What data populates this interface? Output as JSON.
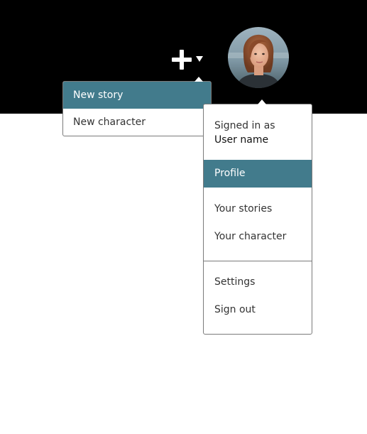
{
  "colors": {
    "topbar": "#000000",
    "accent": "#427b8c",
    "menu_border": "#7a7a7a",
    "text": "#333333"
  },
  "header": {
    "create_icon": "plus-icon",
    "create_caret_icon": "caret-down-icon",
    "avatar_icon": "user-avatar"
  },
  "create_menu": {
    "items": [
      {
        "label": "New story",
        "active": true
      },
      {
        "label": "New character",
        "active": false
      }
    ]
  },
  "user_menu": {
    "signed_in_label": "Signed in as",
    "user_name": "User name",
    "items": [
      {
        "label": "Profile",
        "active": true
      },
      {
        "label": "Your stories",
        "active": false
      },
      {
        "label": "Your character",
        "active": false
      },
      {
        "label": "Settings",
        "active": false
      },
      {
        "label": "Sign out",
        "active": false
      }
    ]
  }
}
